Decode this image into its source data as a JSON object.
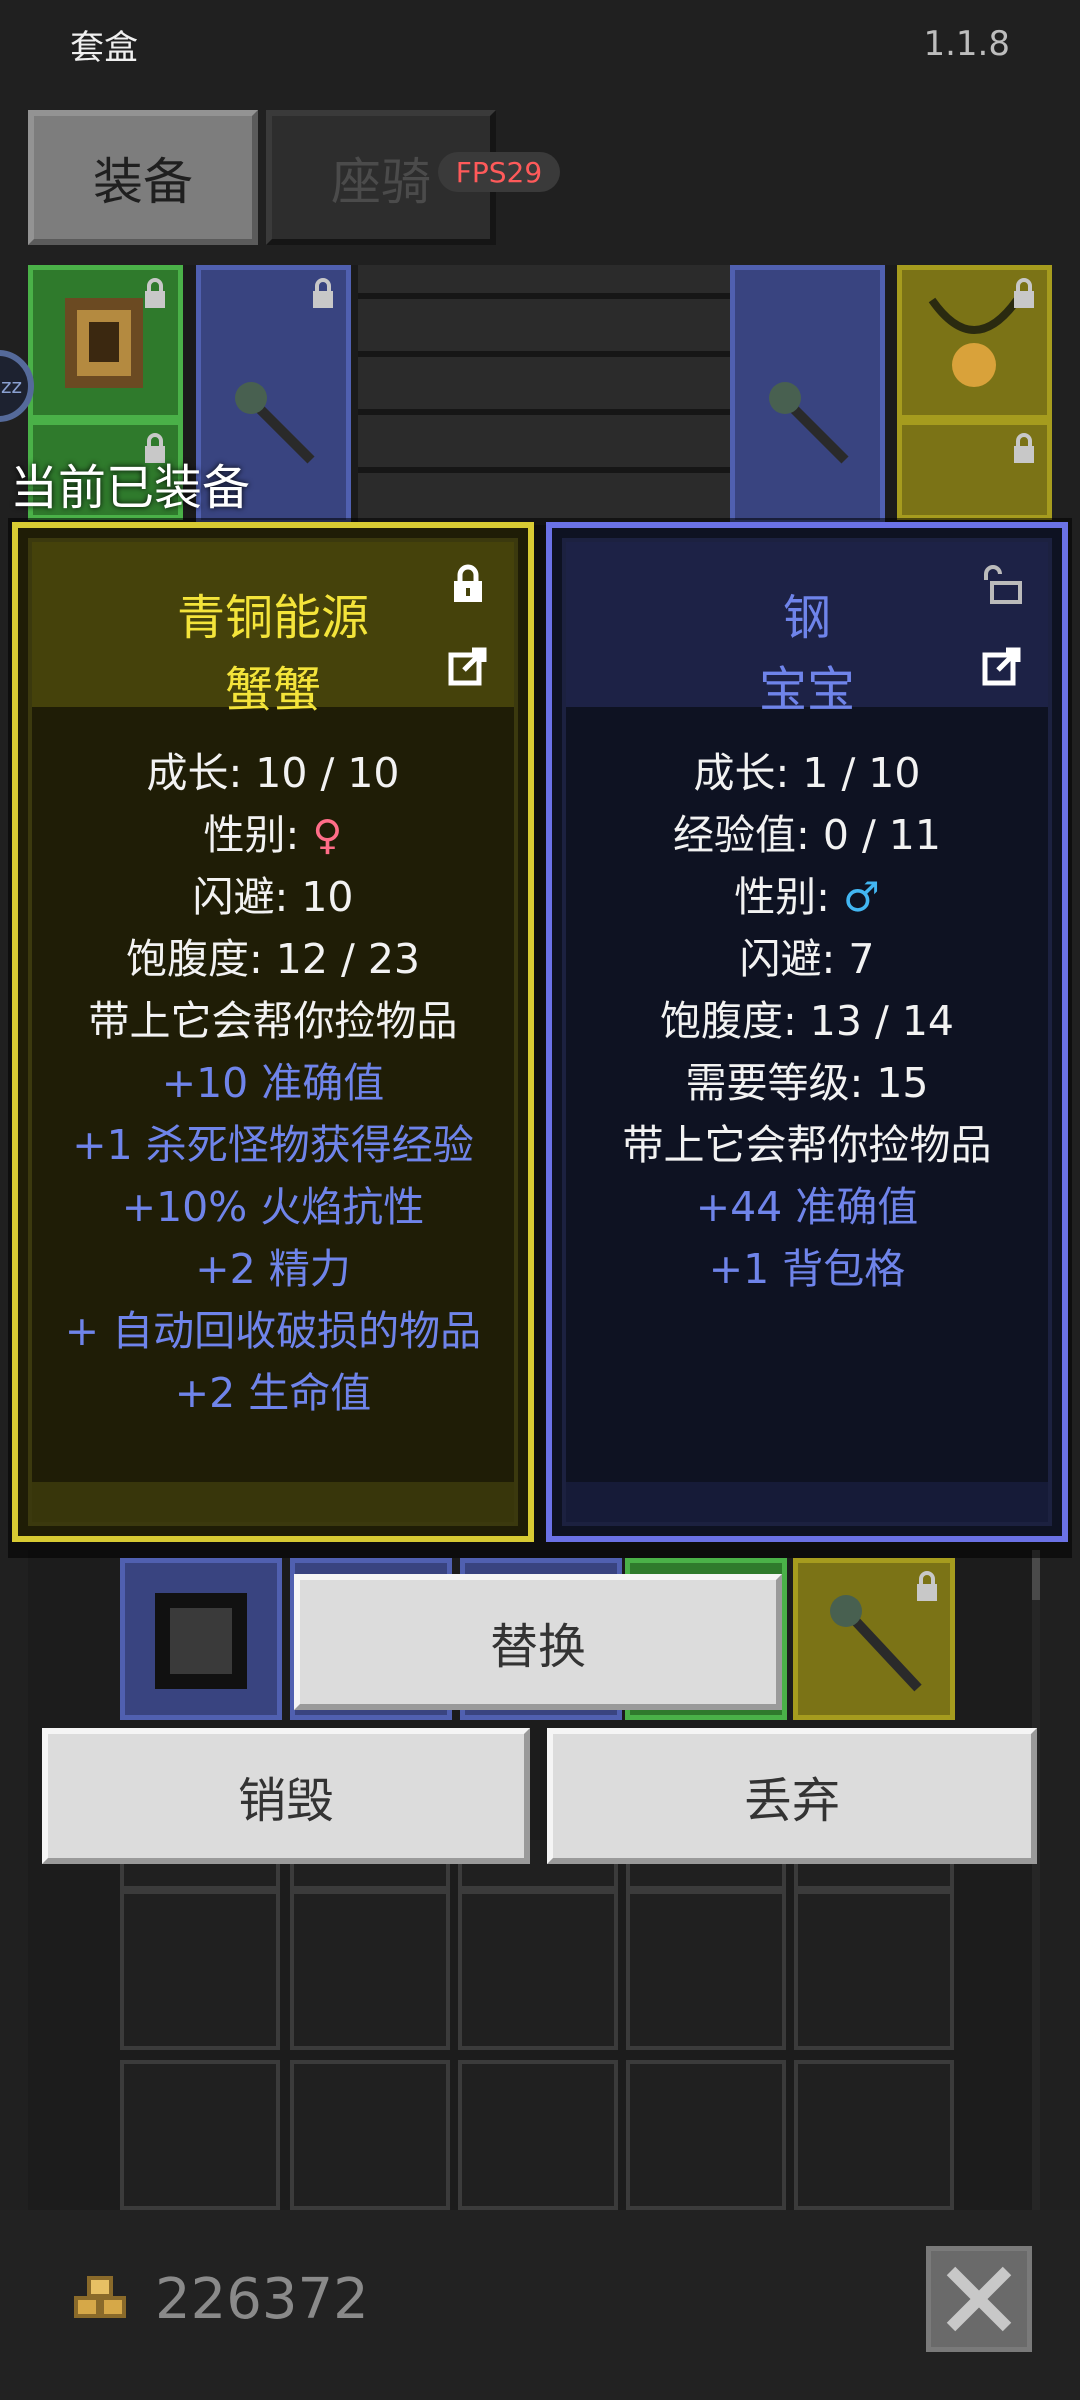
{
  "header": {
    "title": "套盒",
    "version": "1.1.8"
  },
  "tabs": [
    {
      "label": "装备",
      "active": true
    },
    {
      "label": "座骑",
      "active": false
    }
  ],
  "fps_badge": "FPS29",
  "equipped_label": "当前已装备",
  "left_card": {
    "name": "青铜能源",
    "subname": "蟹蟹",
    "stats": [
      {
        "text": "成长: 10 / 10",
        "kind": "white"
      },
      {
        "text": "性别: ",
        "symbol": "♀",
        "kind": "gender-female"
      },
      {
        "text": "闪避: 10",
        "kind": "white"
      },
      {
        "text": "饱腹度: 12 / 23",
        "kind": "white"
      },
      {
        "text": "带上它会帮你捡物品",
        "kind": "white"
      },
      {
        "text": "+10 准确值",
        "kind": "blue"
      },
      {
        "text": "+1 杀死怪物获得经验",
        "kind": "blue"
      },
      {
        "text": "+10% 火焰抗性",
        "kind": "blue"
      },
      {
        "text": "+2 精力",
        "kind": "blue"
      },
      {
        "text": "+ 自动回收破损的物品",
        "kind": "blue"
      },
      {
        "text": "+2 生命值",
        "kind": "blue"
      }
    ],
    "locked": true
  },
  "right_card": {
    "name": "钢",
    "subname": "宝宝",
    "stats": [
      {
        "text": "成长: 1 / 10",
        "kind": "white"
      },
      {
        "text": "经验值: 0 / 11",
        "kind": "white"
      },
      {
        "text": "性别: ",
        "symbol": "♂",
        "kind": "gender-male"
      },
      {
        "text": "闪避: 7",
        "kind": "white"
      },
      {
        "text": "饱腹度: 13 / 14",
        "kind": "white"
      },
      {
        "text": "需要等级: 15",
        "kind": "white"
      },
      {
        "text": "带上它会帮你捡物品",
        "kind": "white"
      },
      {
        "text": "+44 准确值",
        "kind": "blue"
      },
      {
        "text": "+1 背包格",
        "kind": "blue"
      }
    ],
    "locked": false
  },
  "buttons": {
    "replace": "替换",
    "destroy": "销毁",
    "drop": "丢弃"
  },
  "gold": "226372",
  "colors": {
    "left_border": "#d8cb33",
    "right_border": "#6b72e6",
    "name_yellow": "#f4e43a",
    "name_blue": "#6f84ea"
  },
  "icons": {
    "lock": "lock-icon",
    "unlock": "unlock-icon",
    "export": "export-icon",
    "close": "close-icon",
    "gold": "gold-coins-icon"
  }
}
